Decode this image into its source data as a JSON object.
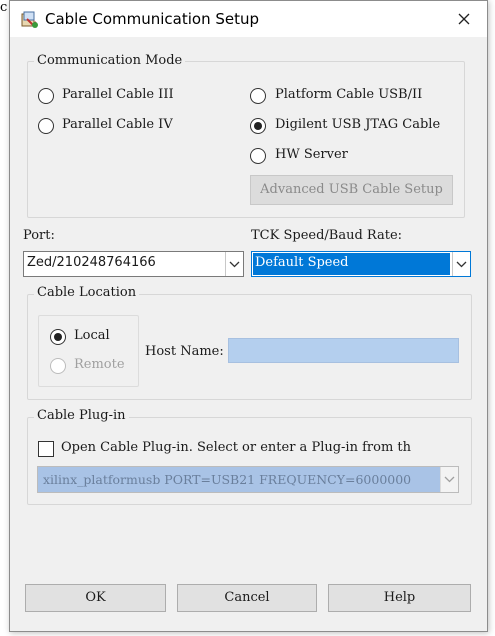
{
  "background_edge_text": "c",
  "window": {
    "title": "Cable Communication Setup",
    "close_glyph": "✕"
  },
  "communication_mode": {
    "label": "Communication Mode",
    "options": [
      {
        "label": "Parallel Cable III",
        "checked": false
      },
      {
        "label": "Parallel Cable IV",
        "checked": false
      },
      {
        "label": "Platform Cable USB/II",
        "checked": false
      },
      {
        "label": "Digilent USB JTAG Cable",
        "checked": true
      },
      {
        "label": "HW Server",
        "checked": false
      }
    ],
    "advanced_button": "Advanced USB Cable Setup"
  },
  "port": {
    "label": "Port:",
    "value": "Zed/210248764166"
  },
  "tck": {
    "label": "TCK Speed/Baud Rate:",
    "value": "Default Speed"
  },
  "cable_location": {
    "label": "Cable Location",
    "local_label": "Local",
    "remote_label": "Remote",
    "host_name_label": "Host Name:",
    "host_name_value": ""
  },
  "cable_plugin": {
    "label": "Cable Plug-in",
    "checkbox_label": "Open Cable Plug-in. Select or enter a Plug-in from th",
    "checked": false,
    "plugin_value": "xilinx_platformusb PORT=USB21 FREQUENCY=6000000"
  },
  "buttons": {
    "ok": "OK",
    "cancel": "Cancel",
    "help": "Help"
  },
  "colors": {
    "selection_blue": "#0078d7",
    "host_field_blue": "#b4cfee",
    "disabled_combo": "#a9c3e6"
  }
}
